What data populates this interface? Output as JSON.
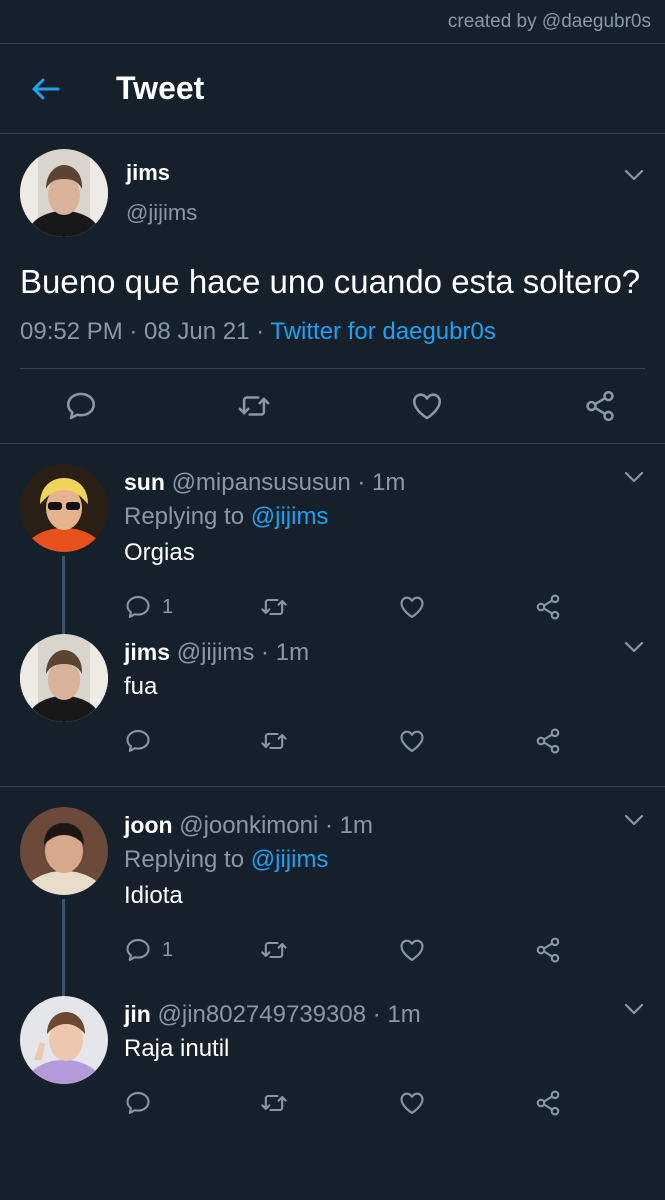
{
  "credit": "created by @daegubr0s",
  "header": {
    "title": "Tweet"
  },
  "tweet": {
    "name": "jims",
    "handle": "@jijims",
    "text": "Bueno que hace uno cuando esta soltero?",
    "time": "09:52 PM · 08 Jun 21 · ",
    "source": "Twitter for daegubr0s"
  },
  "replies": [
    {
      "name": "sun",
      "handle": "@mipansususun · 1m",
      "replying_prefix": "Replying to ",
      "mention": "@jijims",
      "text": "Orgias",
      "reply_count": "1"
    },
    {
      "name": "jims",
      "handle": "@jijims · 1m",
      "text": "fua"
    },
    {
      "name": "joon",
      "handle": "@joonkimoni · 1m",
      "replying_prefix": "Replying to ",
      "mention": "@jijims",
      "text": "Idiota",
      "reply_count": "1"
    },
    {
      "name": "jin",
      "handle": "@jin802749739308 · 1m",
      "text": "Raja inutil"
    }
  ],
  "colors": {
    "background": "#15202b",
    "accent": "#1da1f2",
    "muted": "#8899a6",
    "border": "#38444d"
  },
  "icons": [
    "back-arrow-icon",
    "chevron-down-icon",
    "reply-icon",
    "retweet-icon",
    "like-icon",
    "share-icon"
  ]
}
